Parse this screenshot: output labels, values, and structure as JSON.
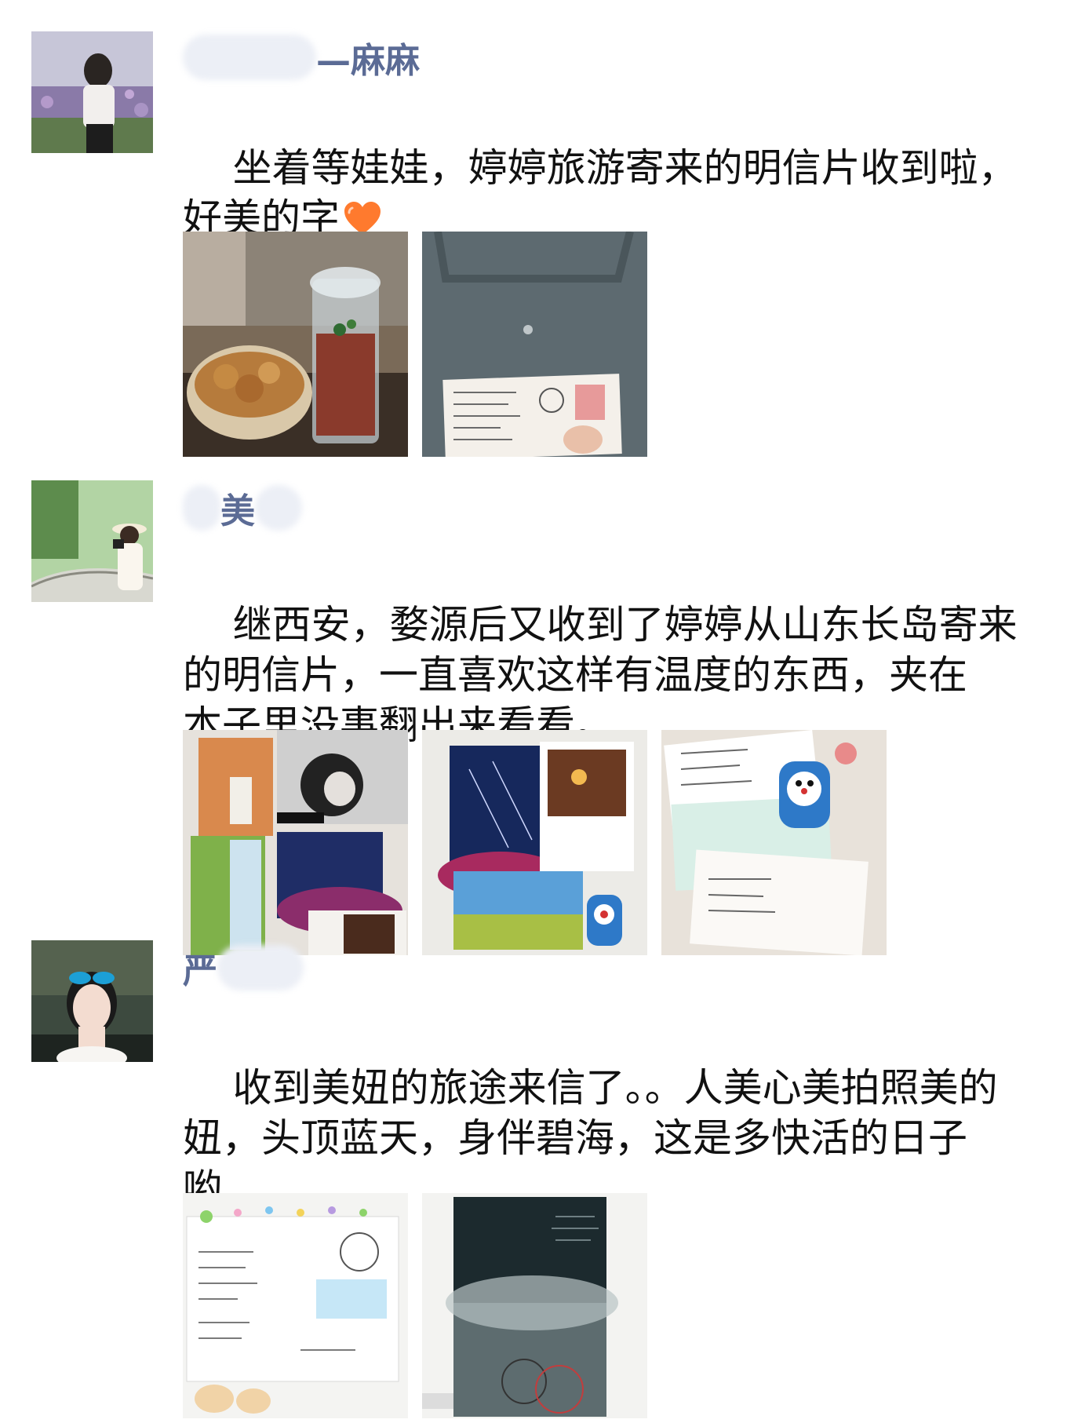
{
  "posts": [
    {
      "author": {
        "visible_name": "—麻麻"
      },
      "text": "坐着等娃娃，婷婷旅游寄来的明信片收到啦，\n好美的字",
      "emoji": "heart-icon",
      "images": [
        "food-and-drink-photo",
        "postcard-on-bag-photo"
      ]
    },
    {
      "author": {
        "visible_name": "美"
      },
      "text": "继西安，婺源后又收到了婷婷从山东长岛寄来\n的明信片，一直喜欢这样有温度的东西，夹在\n本子里没事翻出来看看。",
      "images": [
        "postcards-collage-photo",
        "postcards-starry-photo",
        "postcards-doraemon-photo"
      ]
    },
    {
      "author": {
        "visible_name": "严"
      },
      "text": "收到美妞的旅途来信了。。人美心美拍照美的\n妞，头顶蓝天，身伴碧海，这是多快活的日子\n哟",
      "images": [
        "handwritten-postcard-photo",
        "night-sky-postcard-photo"
      ]
    }
  ],
  "colors": {
    "name": "#5b6b95",
    "text": "#111111",
    "heart": "#ff7a2e"
  }
}
